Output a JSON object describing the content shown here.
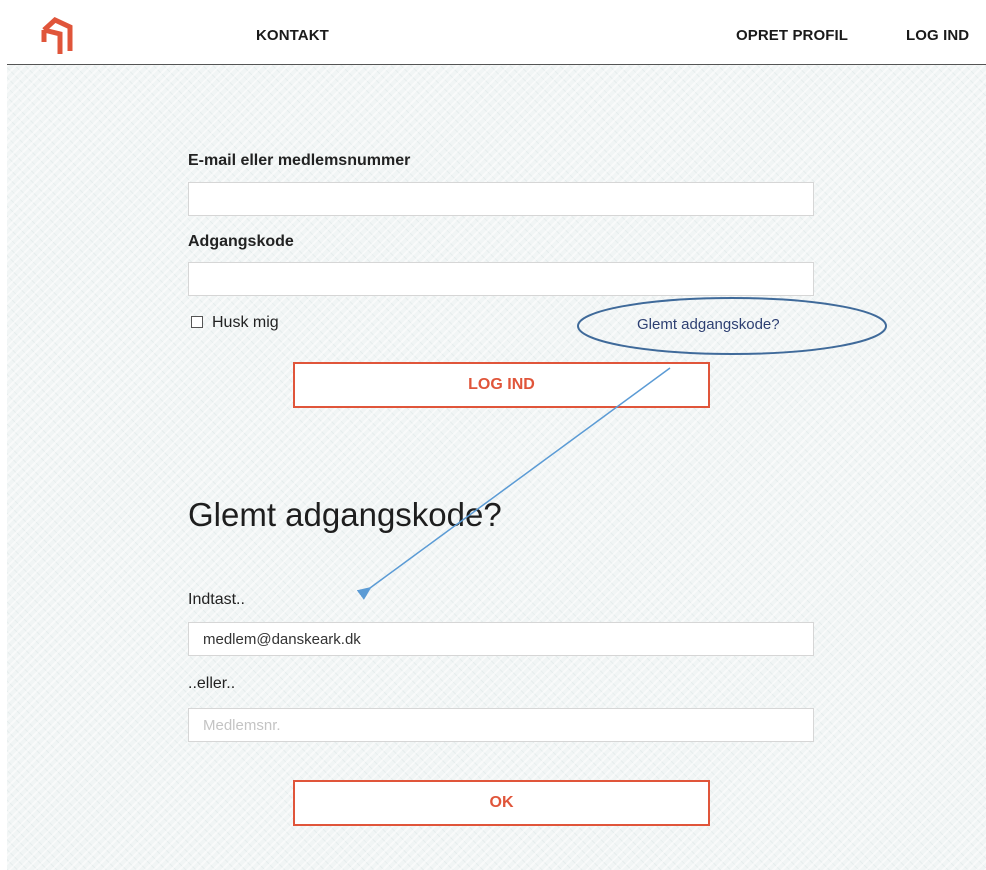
{
  "caption": "",
  "header": {
    "nav": {
      "contact": "KONTAKT",
      "create_profile": "OPRET PROFIL",
      "login": "LOG IND"
    }
  },
  "login_form": {
    "email_label": "E-mail eller medlemsnummer",
    "email_value": "",
    "password_label": "Adgangskode",
    "password_value": "",
    "remember_label": "Husk mig",
    "remember_checked": false,
    "forgot_link": "Glemt adgangskode?",
    "submit_label": "LOG IND"
  },
  "forgot_form": {
    "title": "Glemt adgangskode?",
    "enter_label": "Indtast..",
    "email_value": "medlem@danskeark.dk",
    "or_label": "..eller..",
    "member_no_placeholder": "Medlemsnr.",
    "submit_label": "OK"
  },
  "colors": {
    "accent": "#e0553a",
    "link": "#2d3f72",
    "annotation": "#3f6a9a",
    "arrow": "#5b9bd5"
  },
  "icons": {
    "logo": "brand-logo-icon",
    "annotation_ellipse": "highlight-ellipse-icon",
    "annotation_arrow": "arrow-icon"
  }
}
